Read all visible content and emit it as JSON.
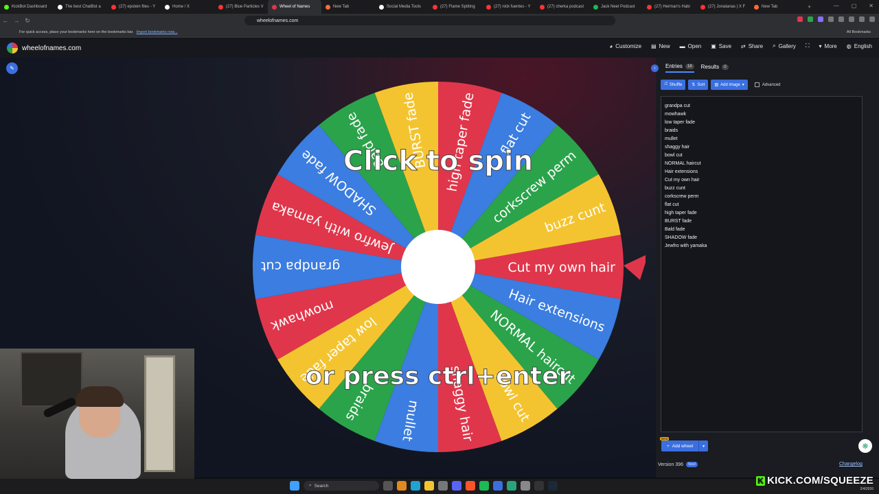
{
  "browser": {
    "tabs": [
      {
        "label": "KickBot Dashboard",
        "color": "#53fc18",
        "active": false
      },
      {
        "label": "The best ChatBot a",
        "color": "#ffffff",
        "active": false
      },
      {
        "label": "(27) epstein files - Y",
        "color": "#ff3333",
        "active": false
      },
      {
        "label": "Home / X",
        "color": "#ffffff",
        "active": false
      },
      {
        "label": "(27) Blue Particles V",
        "color": "#ff3333",
        "active": false
      },
      {
        "label": "Wheel of Names",
        "color": "#e0364b",
        "active": true
      },
      {
        "label": "New Tab",
        "color": "#ff6a3d",
        "active": false
      },
      {
        "label": "Social Media Tools",
        "color": "#ffffff",
        "active": false
      },
      {
        "label": "(27) Flame Spitting",
        "color": "#ff3333",
        "active": false
      },
      {
        "label": "(27) nick fuentes - Y",
        "color": "#ff3333",
        "active": false
      },
      {
        "label": "(27) cherka podcast",
        "color": "#ff3333",
        "active": false
      },
      {
        "label": "Jack Neel Podcast",
        "color": "#1db954",
        "active": false
      },
      {
        "label": "(27) Herman's Habi",
        "color": "#ff3333",
        "active": false
      },
      {
        "label": "(27) Jonatanas | X F",
        "color": "#ff3333",
        "active": false
      },
      {
        "label": "New Tab",
        "color": "#ff6a3d",
        "active": false
      }
    ],
    "url": "wheelofnames.com",
    "bookmarks_hint": "For quick access, place your bookmarks here on the bookmarks bar.",
    "import_link": "Import bookmarks now...",
    "all_bookmarks": "All Bookmarks"
  },
  "header": {
    "site_name": "wheelofnames.com",
    "nav": [
      {
        "label": "Customize",
        "icon": "palette-icon",
        "glyph": "◕"
      },
      {
        "label": "New",
        "icon": "file-icon",
        "glyph": "▤"
      },
      {
        "label": "Open",
        "icon": "folder-icon",
        "glyph": "▬"
      },
      {
        "label": "Save",
        "icon": "save-icon",
        "glyph": "▣"
      },
      {
        "label": "Share",
        "icon": "share-icon",
        "glyph": "⇄"
      },
      {
        "label": "Gallery",
        "icon": "search-icon",
        "glyph": "⌕"
      },
      {
        "label": "",
        "icon": "fullscreen-icon",
        "glyph": "⛶"
      },
      {
        "label": "More",
        "icon": "chevron-down-icon",
        "glyph": "▾"
      },
      {
        "label": "English",
        "icon": "globe-icon",
        "glyph": "◍"
      }
    ]
  },
  "wheel": {
    "overlay_top": "Click to spin",
    "overlay_bottom": "or press ctrl+enter",
    "segments": [
      {
        "label": "Cut my own hair",
        "color": "#e0364b"
      },
      {
        "label": "Hair extensions",
        "color": "#3b7de0"
      },
      {
        "label": "NORMAL haircut",
        "color": "#2ba34a"
      },
      {
        "label": "bowl cut",
        "color": "#f4c430"
      },
      {
        "label": "shaggy hair",
        "color": "#e0364b"
      },
      {
        "label": "mullet",
        "color": "#3b7de0"
      },
      {
        "label": "braids",
        "color": "#2ba34a"
      },
      {
        "label": "low taper fade",
        "color": "#f4c430"
      },
      {
        "label": "mowhawk",
        "color": "#e0364b"
      },
      {
        "label": "grandpa cut",
        "color": "#3b7de0"
      },
      {
        "label": "Jewfro with yamaka",
        "color": "#e0364b"
      },
      {
        "label": "SHADOW fade",
        "color": "#3b7de0"
      },
      {
        "label": "Bald fade",
        "color": "#2ba34a"
      },
      {
        "label": "BURST fade",
        "color": "#f4c430"
      },
      {
        "label": "high taper fade",
        "color": "#e0364b"
      },
      {
        "label": "flat cut",
        "color": "#3b7de0"
      },
      {
        "label": "corkscrew perm",
        "color": "#2ba34a"
      },
      {
        "label": "buzz cunt",
        "color": "#f4c430"
      }
    ]
  },
  "sidebar": {
    "entries_tab": "Entries",
    "entries_count": "18",
    "results_tab": "Results",
    "results_count": "0",
    "shuffle": "Shuffle",
    "sort": "Sort",
    "add_image": "Add image",
    "advanced": "Advanced",
    "entries": [
      "grandpa cut",
      "mowhawk",
      "low taper fade",
      "braids",
      "mullet",
      "shaggy hair",
      "bowl cut",
      "NORMAL haircut",
      "Hair extensions",
      "Cut my own hair",
      "buzz cunt",
      "corkscrew perm",
      "flat cut",
      "high taper fade",
      "BURST fade",
      "Bald fade",
      "SHADOW fade",
      "Jewfro with yamaka"
    ],
    "add_wheel": "Add wheel",
    "beta": "Beta",
    "version": "Version 396",
    "new_badge": "New!",
    "changelog": "Changelog"
  },
  "taskbar": {
    "search": "Search",
    "kick_text": "KICK.COM/SQUEEZE",
    "kick_k": "K",
    "date": "2/4/2026"
  }
}
